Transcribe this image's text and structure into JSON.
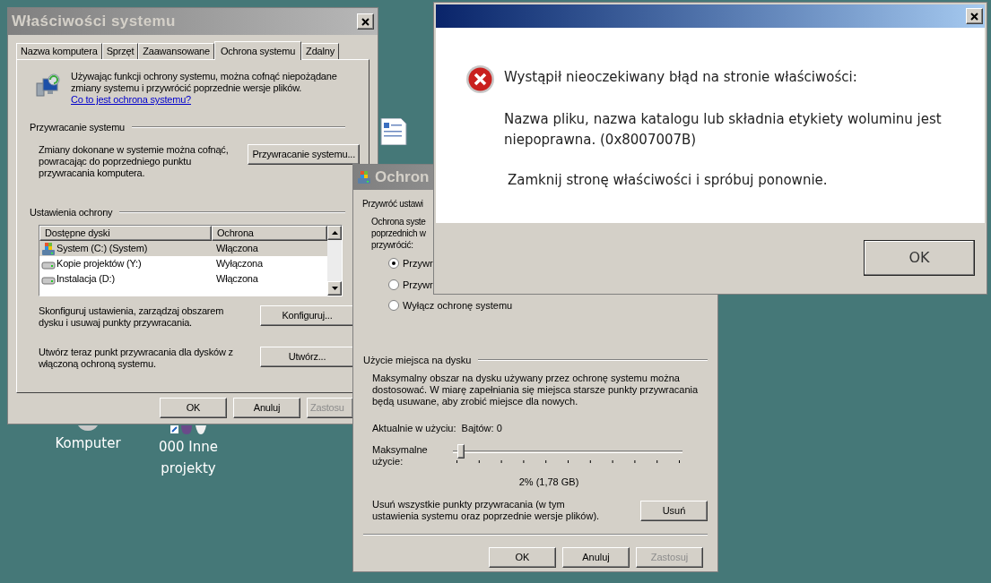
{
  "desktop": {
    "icons": [
      {
        "label": "Komputer",
        "kind": "computer"
      },
      {
        "label": "000 Inne projekty",
        "kind": "shortcut"
      }
    ]
  },
  "system_properties": {
    "title": "Właściwości systemu",
    "tabs": [
      {
        "label": "Nazwa komputera",
        "selected": false
      },
      {
        "label": "Sprzęt",
        "selected": false
      },
      {
        "label": "Zaawansowane",
        "selected": false
      },
      {
        "label": "Ochrona systemu",
        "selected": true
      },
      {
        "label": "Zdalny",
        "selected": false
      }
    ],
    "intro": {
      "text": "Używając funkcji ochrony systemu, można cofnąć niepożądane zmiany systemu i przywrócić poprzednie wersje plików.",
      "link": "Co to jest ochrona systemu?"
    },
    "restore_section": {
      "title": "Przywracanie systemu",
      "text": "Zmiany dokonane w systemie można cofnąć, powracając do poprzedniego punktu przywracania komputera.",
      "button": "Przywracanie systemu..."
    },
    "protection_section": {
      "title": "Ustawienia ochrony",
      "columns": [
        "Dostępne dyski",
        "Ochrona"
      ],
      "rows": [
        {
          "drive": "System (C:) (System)",
          "protection": "Włączona",
          "kind": "system",
          "selected": true
        },
        {
          "drive": "Kopie projektów (Y:)",
          "protection": "Wyłączona",
          "kind": "drive",
          "selected": false
        },
        {
          "drive": "Instalacja (D:)",
          "protection": "Włączona",
          "kind": "drive",
          "selected": false
        }
      ],
      "configure": {
        "text": "Skonfiguruj ustawienia, zarządzaj obszarem dysku i usuwaj punkty przywracania.",
        "button": "Konfiguruj..."
      },
      "create": {
        "text": "Utwórz teraz punkt przywracania dla dysków z włączoną ochroną systemu.",
        "button": "Utwórz..."
      }
    },
    "buttons": [
      {
        "label": "OK",
        "disabled": false
      },
      {
        "label": "Anuluj",
        "disabled": false
      },
      {
        "label": "Zastosu",
        "disabled": true
      }
    ]
  },
  "protection_dialog": {
    "title": "Ochron",
    "section_title": "Przywróć ustawi",
    "description_lines": [
      "Ochrona syste",
      "poprzednich w",
      "przywrócić:"
    ],
    "options": [
      {
        "label": "Przywr",
        "selected": true
      },
      {
        "label": "Przywr",
        "selected": false
      },
      {
        "label": "Wyłącz ochronę systemu",
        "selected": false
      }
    ],
    "disk_usage": {
      "title": "Użycie miejsca na dysku",
      "text": "Maksymalny obszar na dysku używany przez ochronę systemu można dostosować. W miarę zapełniania się miejsca starsze punkty przywracania będą usuwane, aby zrobić miejsce dla nowych.",
      "current_label": "Aktualnie w użyciu:",
      "current_value": "Bajtów: 0",
      "max_label": "Maksymalne użycie:",
      "slider": {
        "level": 0.02
      },
      "reading": "2% (1,78 GB)",
      "delete_text": "Usuń wszystkie punkty przywracania (w tym ustawienia systemu oraz poprzednie wersje plików).",
      "delete_button": "Usuń"
    },
    "buttons": [
      {
        "label": "OK",
        "disabled": false
      },
      {
        "label": "Anuluj",
        "disabled": false
      },
      {
        "label": "Zastosuj",
        "disabled": true
      }
    ]
  },
  "error_dialog": {
    "heading": "Wystąpił nieoczekiwany błąd na stronie właściwości:",
    "message": "Nazwa pliku, nazwa katalogu lub składnia etykiety woluminu jest niepoprawna. (0x8007007B)",
    "hint": "Zamknij stronę właściwości i spróbuj ponownie.",
    "button": "OK"
  }
}
